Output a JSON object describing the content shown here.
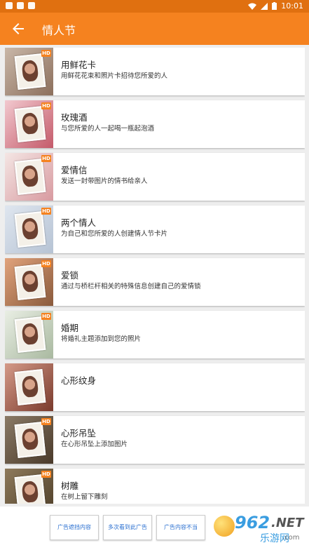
{
  "status_bar": {
    "time": "10:01"
  },
  "app_bar": {
    "title": "情人节"
  },
  "hd_label": "HD",
  "items": [
    {
      "title": "用鲜花卡",
      "subtitle": "用鲜花花束和照片卡招待您所爱的人",
      "hd": true,
      "bg": [
        "#c9b7a8",
        "#8c6f5c"
      ]
    },
    {
      "title": "玫瑰酒",
      "subtitle": "与您所爱的人一起喝一瓶起泡酒",
      "hd": true,
      "bg": [
        "#f2c9cf",
        "#c45a6a"
      ]
    },
    {
      "title": "爱情信",
      "subtitle": "发送一封带图片的情书给亲人",
      "hd": true,
      "bg": [
        "#f4e6e4",
        "#d89aa0"
      ]
    },
    {
      "title": "两个情人",
      "subtitle": "为自己和您所爱的人创建情人节卡片",
      "hd": true,
      "bg": [
        "#dfe6ef",
        "#b6c3d4"
      ]
    },
    {
      "title": "爱锁",
      "subtitle": "通过与桥栏杆相关的特殊信息创建自己的爱情锁",
      "hd": true,
      "bg": [
        "#e1a37c",
        "#8a5a3c"
      ]
    },
    {
      "title": "婚期",
      "subtitle": "将婚礼主题添加到您的照片",
      "hd": true,
      "bg": [
        "#e9eee4",
        "#a9b9a0"
      ]
    },
    {
      "title": "心形纹身",
      "subtitle": "",
      "hd": false,
      "bg": [
        "#d49a88",
        "#7a3a2c"
      ]
    },
    {
      "title": "心形吊坠",
      "subtitle": "在心形吊坠上添加图片",
      "hd": true,
      "bg": [
        "#8a7a66",
        "#4a3a2a"
      ]
    },
    {
      "title": "树雕",
      "subtitle": "在树上留下雕刻",
      "hd": true,
      "bg": [
        "#8e7a5c",
        "#4e3e28"
      ]
    }
  ],
  "feedback_buttons": [
    "广告遮挡内容",
    "多次看到此广告",
    "广告内容不当"
  ],
  "watermark": {
    "number": "962",
    "suffix": ".NET",
    "cn": "乐游网",
    "domain": ".com"
  }
}
